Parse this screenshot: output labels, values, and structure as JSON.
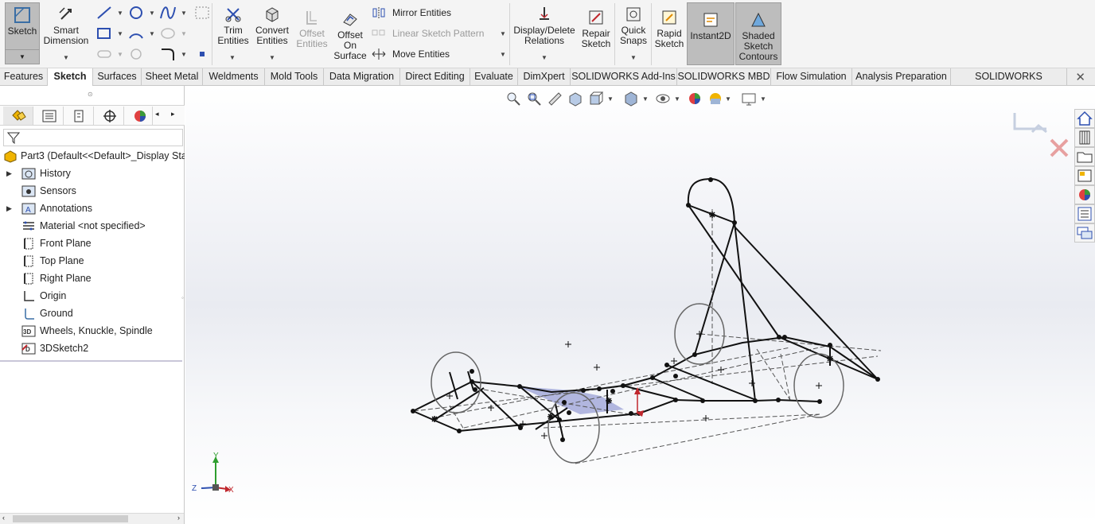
{
  "ribbon": {
    "sketch": "Sketch",
    "smart_dimension": "Smart Dimension",
    "trim_entities": "Trim Entities",
    "convert_entities": "Convert Entities",
    "offset_entities": "Offset Entities",
    "offset_on_surface": "Offset On Surface",
    "mirror_entities": "Mirror Entities",
    "linear_sketch_pattern": "Linear Sketch Pattern",
    "move_entities": "Move Entities",
    "display_delete_relations": "Display/Delete Relations",
    "repair_sketch": "Repair Sketch",
    "quick_snaps": "Quick Snaps",
    "rapid_sketch": "Rapid Sketch",
    "instant2d": "Instant2D",
    "shaded_sketch_contours": "Shaded Sketch Contours"
  },
  "tabs": [
    "Features",
    "Sketch",
    "Surfaces",
    "Sheet Metal",
    "Weldments",
    "Mold Tools",
    "Data Migration",
    "Direct Editing",
    "Evaluate",
    "DimXpert",
    "SOLIDWORKS Add-Ins",
    "SOLIDWORKS MBD",
    "Flow Simulation",
    "Analysis Preparation",
    "SOLIDWORKS Inspection"
  ],
  "active_tab": "Sketch",
  "tree": {
    "root": "Part3  (Default<<Default>_Display Sta",
    "items": [
      {
        "label": "History",
        "icon": "history-folder-icon",
        "expandable": true
      },
      {
        "label": "Sensors",
        "icon": "sensors-folder-icon",
        "expandable": false
      },
      {
        "label": "Annotations",
        "icon": "annotations-folder-icon",
        "expandable": true
      },
      {
        "label": "Material <not specified>",
        "icon": "material-icon",
        "expandable": false
      },
      {
        "label": "Front Plane",
        "icon": "plane-icon",
        "expandable": false
      },
      {
        "label": "Top Plane",
        "icon": "plane-icon",
        "expandable": false
      },
      {
        "label": "Right Plane",
        "icon": "plane-icon",
        "expandable": false
      },
      {
        "label": "Origin",
        "icon": "origin-icon",
        "expandable": false
      },
      {
        "label": "Ground",
        "icon": "sketch-icon",
        "expandable": false
      },
      {
        "label": "Wheels, Knuckle, Spindle",
        "icon": "3dsketch-icon",
        "expandable": false
      },
      {
        "label": "3DSketch2",
        "icon": "3dsketch-edit-icon",
        "expandable": false
      }
    ]
  },
  "triad": {
    "x": "X",
    "y": "Y",
    "z": "Z"
  },
  "colors": {
    "accent": "#3a6ea5",
    "pressed": "#bdbdbd",
    "selection": "#9aa0d6",
    "triad_y": "#2e9e2e",
    "triad_x": "#c0272d",
    "triad_z": "#2d4fb0"
  }
}
